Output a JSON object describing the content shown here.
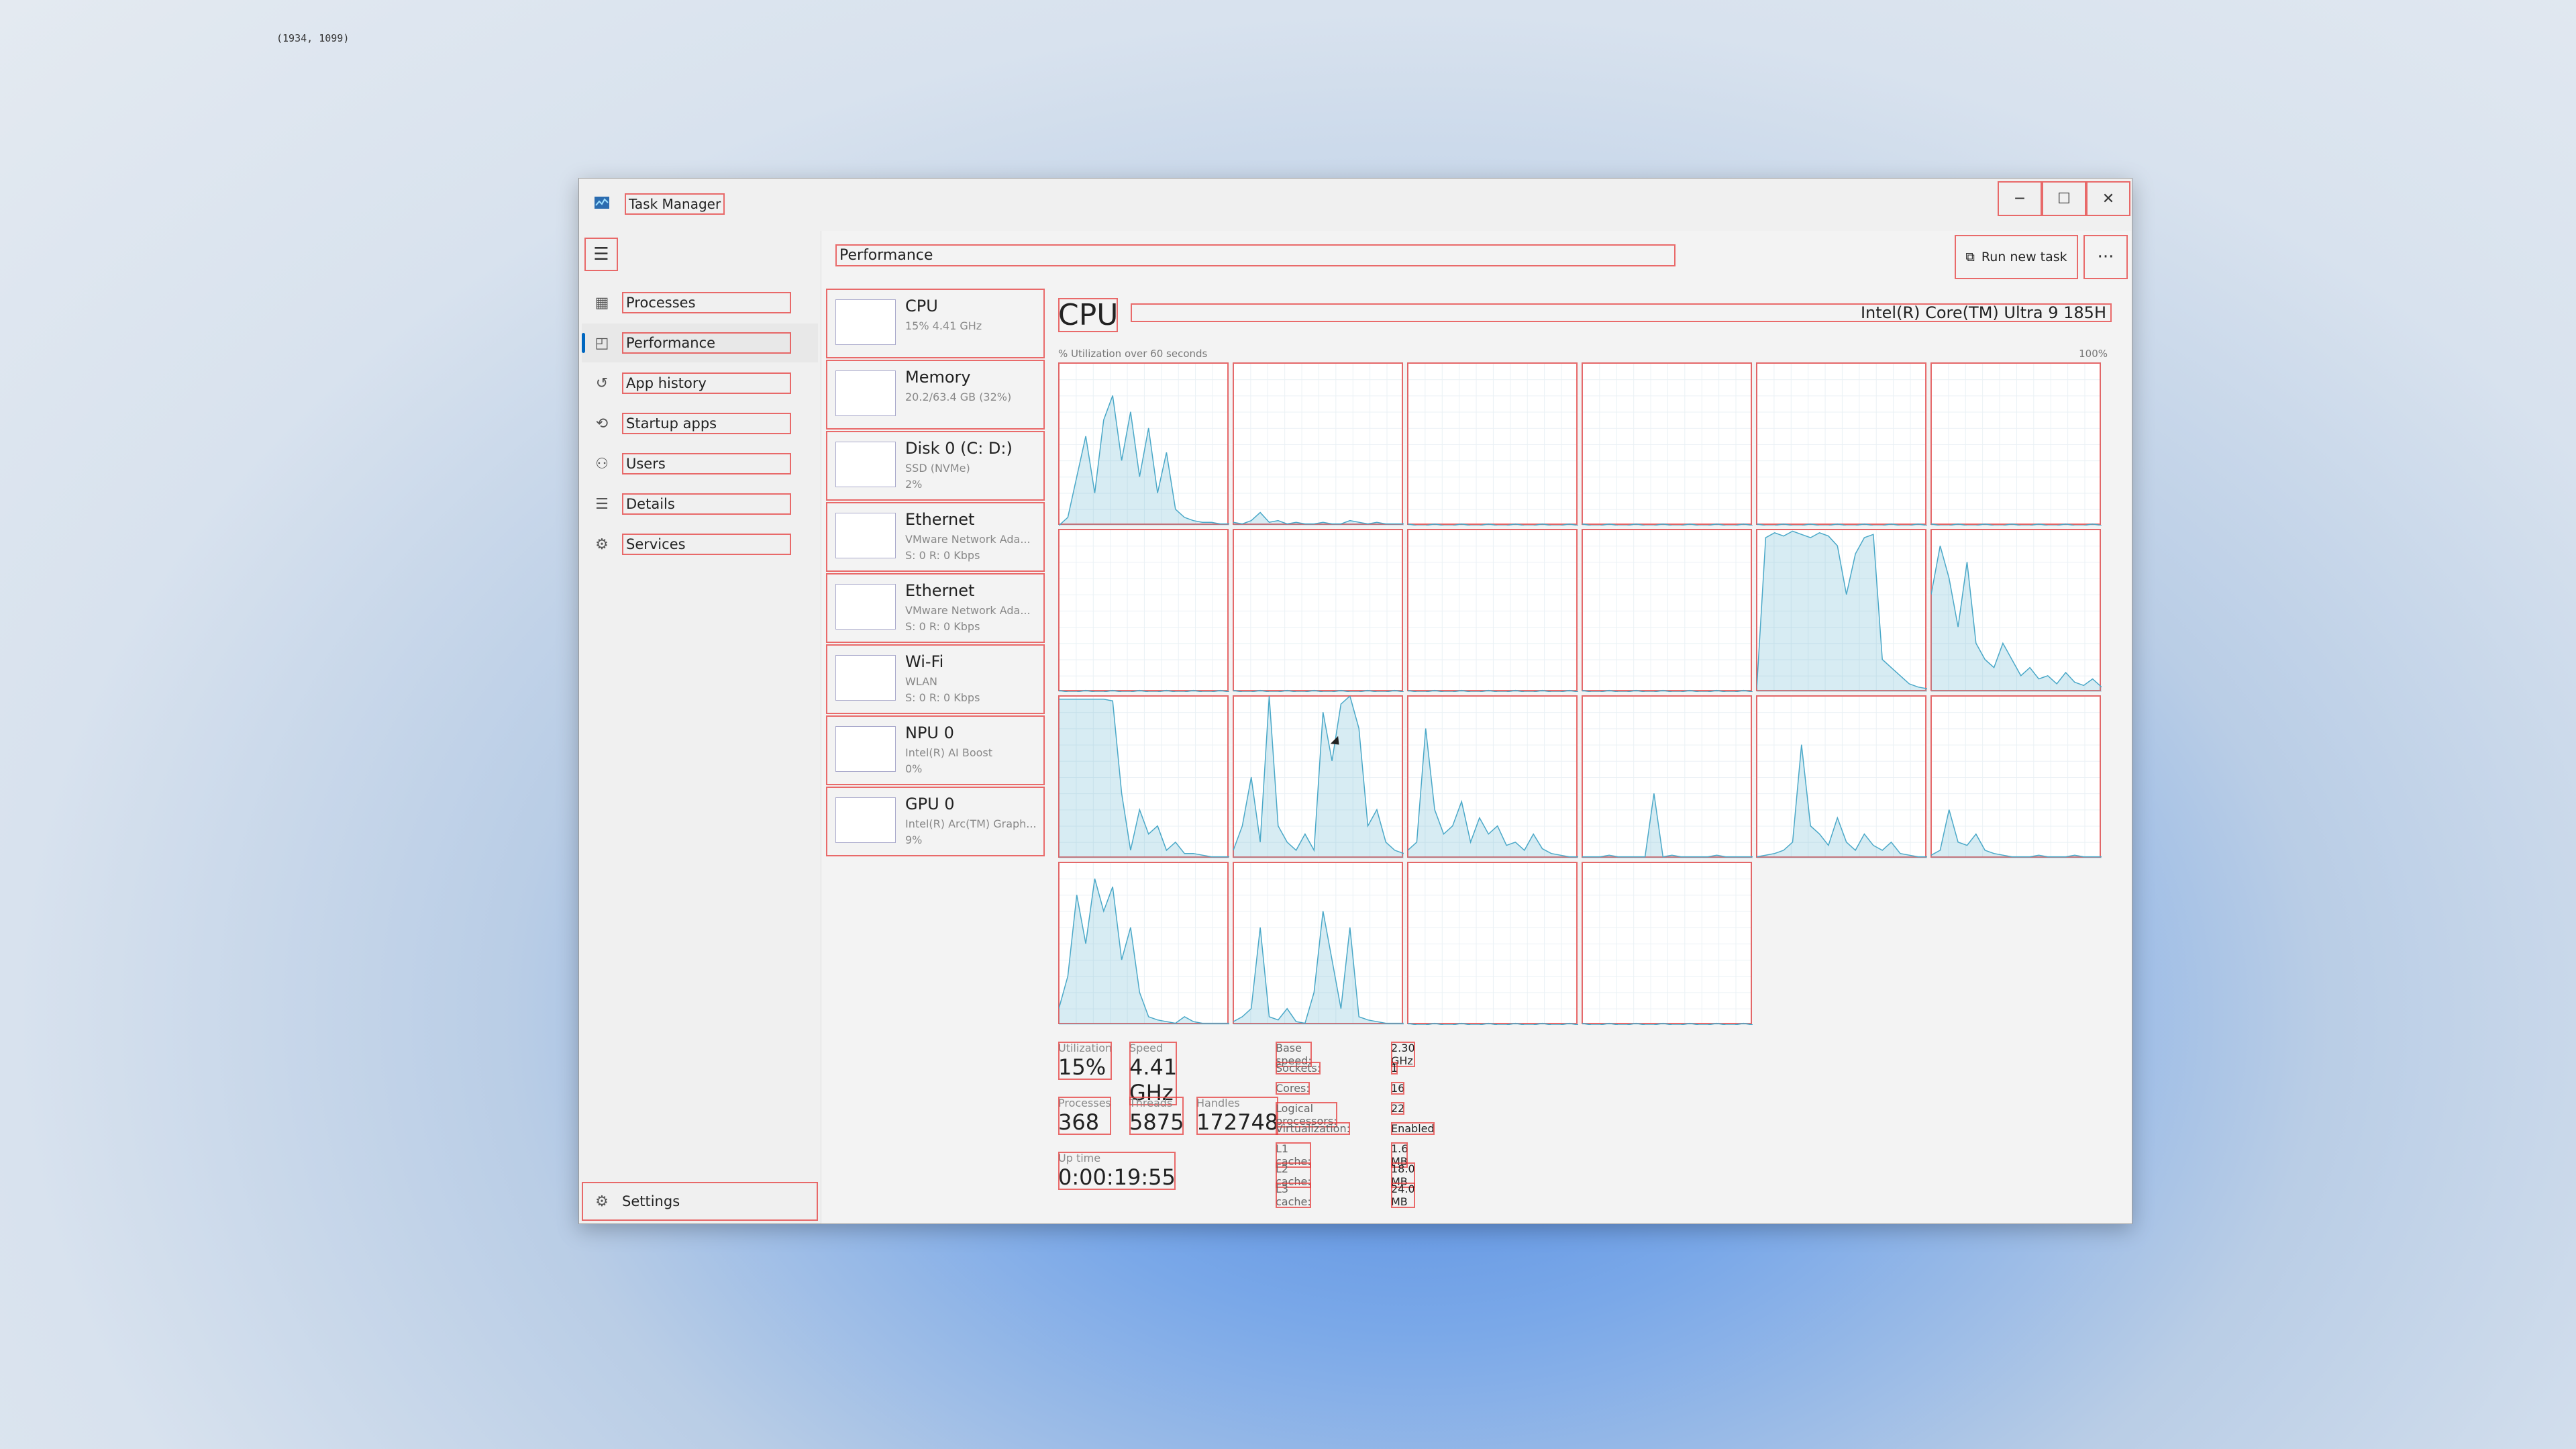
{
  "coords_readout": "(1934, 1099)",
  "window": {
    "title": "Task Manager",
    "minimize": "─",
    "maximize": "☐",
    "close": "✕"
  },
  "sidebar": {
    "menu_icon": "hamburger-icon",
    "items": [
      {
        "label": "Processes",
        "icon": "processes-icon",
        "glyph": "▦"
      },
      {
        "label": "Performance",
        "icon": "performance-icon",
        "glyph": "◰"
      },
      {
        "label": "App history",
        "icon": "app-history-icon",
        "glyph": "↺"
      },
      {
        "label": "Startup apps",
        "icon": "startup-icon",
        "glyph": "⟲"
      },
      {
        "label": "Users",
        "icon": "users-icon",
        "glyph": "⚇"
      },
      {
        "label": "Details",
        "icon": "details-icon",
        "glyph": "☰"
      },
      {
        "label": "Services",
        "icon": "services-icon",
        "glyph": "⚙"
      }
    ],
    "settings": "Settings"
  },
  "header": {
    "page_title": "Performance",
    "run_new_task": "Run new task",
    "more": "···"
  },
  "devices": [
    {
      "name": "CPU",
      "sub": [
        "15% 4.41 GHz"
      ]
    },
    {
      "name": "Memory",
      "sub": [
        "20.2/63.4 GB (32%)"
      ]
    },
    {
      "name": "Disk 0 (C: D:)",
      "sub": [
        "SSD (NVMe)",
        "2%"
      ]
    },
    {
      "name": "Ethernet",
      "sub": [
        "VMware Network Ada...",
        "S: 0 R: 0 Kbps"
      ]
    },
    {
      "name": "Ethernet",
      "sub": [
        "VMware Network Ada...",
        "S: 0 R: 0 Kbps"
      ]
    },
    {
      "name": "Wi-Fi",
      "sub": [
        "WLAN",
        "S: 0 R: 0 Kbps"
      ]
    },
    {
      "name": "NPU 0",
      "sub": [
        "Intel(R) AI Boost",
        "0%"
      ]
    },
    {
      "name": "GPU 0",
      "sub": [
        "Intel(R) Arc(TM) Graph...",
        "9%"
      ]
    }
  ],
  "cpu": {
    "title": "CPU",
    "model": "Intel(R) Core(TM) Ultra 9 185H",
    "util_label": "% Utilization over 60 seconds",
    "util_max": "100%",
    "stats": {
      "utilization_label": "Utilization",
      "utilization": "15%",
      "speed_label": "Speed",
      "speed": "4.41 GHz",
      "processes_label": "Processes",
      "processes": "368",
      "threads_label": "Threads",
      "threads": "5875",
      "handles_label": "Handles",
      "handles": "172748",
      "uptime_label": "Up time",
      "uptime": "0:00:19:55"
    },
    "specs": [
      {
        "k": "Base speed:",
        "v": "2.30 GHz"
      },
      {
        "k": "Sockets:",
        "v": "1"
      },
      {
        "k": "Cores:",
        "v": "16"
      },
      {
        "k": "Logical processors:",
        "v": "22"
      },
      {
        "k": "Virtualization:",
        "v": "Enabled"
      },
      {
        "k": "L1 cache:",
        "v": "1.6 MB"
      },
      {
        "k": "L2 cache:",
        "v": "18.0 MB"
      },
      {
        "k": "L3 cache:",
        "v": "24.0 MB"
      }
    ],
    "core_activity": [
      [
        0,
        5,
        30,
        55,
        20,
        65,
        80,
        40,
        70,
        30,
        60,
        20,
        45,
        10,
        5,
        3,
        2,
        2,
        1,
        1
      ],
      [
        2,
        1,
        3,
        8,
        2,
        3,
        1,
        2,
        1,
        1,
        2,
        1,
        1,
        3,
        2,
        1,
        2,
        1,
        1,
        1
      ],
      [
        1,
        0,
        0,
        1,
        0,
        0,
        1,
        0,
        0,
        1,
        0,
        0,
        1,
        0,
        0,
        1,
        0,
        0,
        1,
        0
      ],
      [
        1,
        0,
        0,
        1,
        0,
        0,
        1,
        0,
        0,
        1,
        0,
        0,
        1,
        0,
        0,
        1,
        0,
        0,
        1,
        0
      ],
      [
        1,
        0,
        0,
        1,
        0,
        0,
        1,
        0,
        0,
        1,
        0,
        0,
        1,
        0,
        0,
        1,
        0,
        0,
        1,
        0
      ],
      [
        1,
        0,
        0,
        1,
        0,
        0,
        1,
        0,
        0,
        1,
        0,
        0,
        1,
        0,
        0,
        1,
        0,
        0,
        1,
        0
      ],
      [
        1,
        0,
        0,
        1,
        0,
        0,
        1,
        0,
        0,
        1,
        0,
        0,
        1,
        0,
        0,
        1,
        0,
        0,
        1,
        0
      ],
      [
        1,
        0,
        0,
        1,
        0,
        0,
        1,
        0,
        0,
        1,
        0,
        0,
        1,
        0,
        0,
        1,
        0,
        0,
        1,
        0
      ],
      [
        1,
        0,
        0,
        1,
        0,
        0,
        1,
        0,
        0,
        1,
        0,
        0,
        1,
        0,
        0,
        1,
        0,
        0,
        1,
        0
      ],
      [
        1,
        0,
        0,
        1,
        0,
        0,
        1,
        0,
        0,
        1,
        0,
        0,
        1,
        0,
        0,
        1,
        0,
        0,
        1,
        0
      ],
      [
        2,
        95,
        98,
        96,
        99,
        97,
        95,
        98,
        96,
        90,
        60,
        85,
        95,
        97,
        20,
        15,
        10,
        5,
        3,
        2
      ],
      [
        60,
        90,
        70,
        40,
        80,
        30,
        20,
        15,
        30,
        20,
        10,
        15,
        8,
        10,
        5,
        12,
        6,
        4,
        8,
        3
      ],
      [
        98,
        98,
        98,
        98,
        98,
        98,
        97,
        40,
        5,
        30,
        15,
        20,
        5,
        10,
        3,
        3,
        2,
        1,
        1,
        1
      ],
      [
        5,
        20,
        50,
        10,
        100,
        20,
        10,
        5,
        15,
        5,
        90,
        60,
        95,
        100,
        80,
        20,
        30,
        10,
        5,
        3
      ],
      [
        5,
        10,
        80,
        30,
        15,
        20,
        35,
        10,
        25,
        15,
        20,
        8,
        10,
        5,
        15,
        6,
        3,
        2,
        1,
        1
      ],
      [
        1,
        1,
        1,
        2,
        1,
        1,
        1,
        1,
        40,
        1,
        2,
        1,
        1,
        1,
        1,
        2,
        1,
        1,
        1,
        1
      ],
      [
        1,
        2,
        3,
        5,
        10,
        70,
        20,
        15,
        8,
        25,
        10,
        5,
        15,
        8,
        5,
        10,
        3,
        2,
        1,
        1
      ],
      [
        2,
        5,
        30,
        10,
        8,
        15,
        5,
        3,
        2,
        1,
        1,
        1,
        2,
        1,
        1,
        1,
        2,
        1,
        1,
        1
      ],
      [
        10,
        30,
        80,
        50,
        90,
        70,
        85,
        40,
        60,
        20,
        5,
        3,
        2,
        1,
        5,
        2,
        1,
        1,
        1,
        1
      ],
      [
        2,
        5,
        10,
        60,
        5,
        3,
        10,
        2,
        1,
        20,
        70,
        40,
        10,
        60,
        5,
        3,
        2,
        1,
        1,
        1
      ],
      [
        1,
        0,
        0,
        1,
        0,
        0,
        1,
        0,
        0,
        1,
        0,
        0,
        1,
        0,
        0,
        1,
        0,
        0,
        1,
        0
      ],
      [
        1,
        0,
        0,
        1,
        0,
        0,
        1,
        0,
        0,
        1,
        0,
        0,
        1,
        0,
        0,
        1,
        0,
        0,
        1,
        0
      ]
    ],
    "graph_color": "#4aa8c8"
  }
}
